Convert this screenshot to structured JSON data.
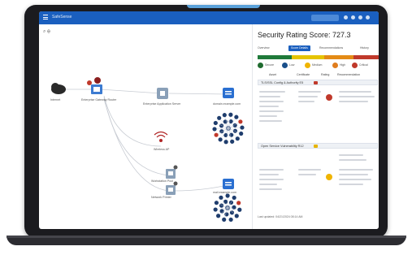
{
  "app": {
    "title": "SafeSense"
  },
  "panel": {
    "title": "Security Rating Score: 727.3",
    "tabs": [
      "Overview",
      "Score Details",
      "Recommendations",
      "History"
    ],
    "score_colors": [
      "#1f7a3a",
      "#e6c400",
      "#e48b16",
      "#c0392b"
    ],
    "legend": [
      {
        "label": "Secure",
        "color": "#1f6b2f"
      },
      {
        "label": "Low",
        "color": "#1a4f8a"
      },
      {
        "label": "Medium",
        "color": "#f0b400"
      },
      {
        "label": "High",
        "color": "#e07d1e"
      },
      {
        "label": "Critical",
        "color": "#c0392b"
      }
    ],
    "columns": [
      "Asset",
      "Certificate",
      "Rating",
      "Recommendation"
    ],
    "sections": [
      {
        "label": "TLS/SSL Config & Authority  E5",
        "badge_color": "#c0392b"
      },
      {
        "label": "Open Service Vulnerability  R12",
        "badge_color": "#e6b400"
      }
    ],
    "row_colors": [
      "#c0392b",
      "#f0b400"
    ],
    "footer": "Last updated: 04/21/2024 08:14 AM"
  },
  "toolbar": {
    "label": "⌕ ⊕"
  },
  "nodes": [
    {
      "name": "cloud",
      "label": "Internet",
      "kind": "cloud"
    },
    {
      "name": "gateway",
      "label": "Enterprise Gateway Router",
      "kind": "server"
    },
    {
      "name": "app-server",
      "label": "Enterprise Application Server",
      "kind": "server"
    },
    {
      "name": "domain-a",
      "label": "domain.example.com",
      "kind": "domain"
    },
    {
      "name": "wifi",
      "label": "Wireless AP",
      "kind": "wifi"
    },
    {
      "name": "host-1",
      "label": "Workstation Pool",
      "kind": "server"
    },
    {
      "name": "host-2",
      "label": "Network Printer",
      "kind": "server"
    },
    {
      "name": "domain-b",
      "label": "mail.example.com",
      "kind": "domain"
    }
  ]
}
